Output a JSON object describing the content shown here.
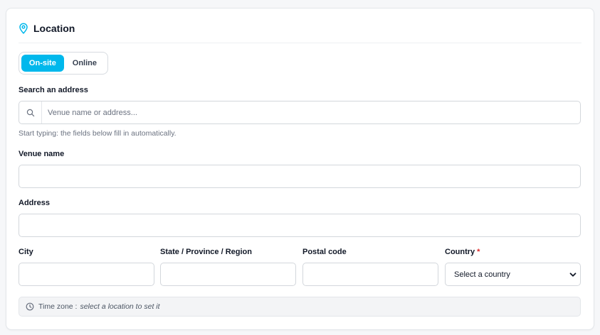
{
  "section": {
    "title": "Location",
    "icon": "map-pin-icon",
    "accent_color": "#00b8ec"
  },
  "mode_toggle": {
    "options": [
      "On-site",
      "Online"
    ],
    "selected": "On-site"
  },
  "search": {
    "label": "Search an address",
    "placeholder": "Venue name or address...",
    "value": "",
    "icon": "search-icon",
    "hint": "Start typing: the fields below fill in automatically."
  },
  "venue": {
    "label": "Venue name",
    "value": ""
  },
  "address": {
    "label": "Address",
    "value": ""
  },
  "city": {
    "label": "City",
    "value": ""
  },
  "state": {
    "label": "State / Province / Region",
    "value": ""
  },
  "postal": {
    "label": "Postal code",
    "value": ""
  },
  "country": {
    "label": "Country",
    "required_mark": "*",
    "selected": "Select a country",
    "icon": "chevron-down-icon"
  },
  "timezone": {
    "icon": "clock-icon",
    "label": "Time zone :",
    "value": "select a location to set it"
  }
}
